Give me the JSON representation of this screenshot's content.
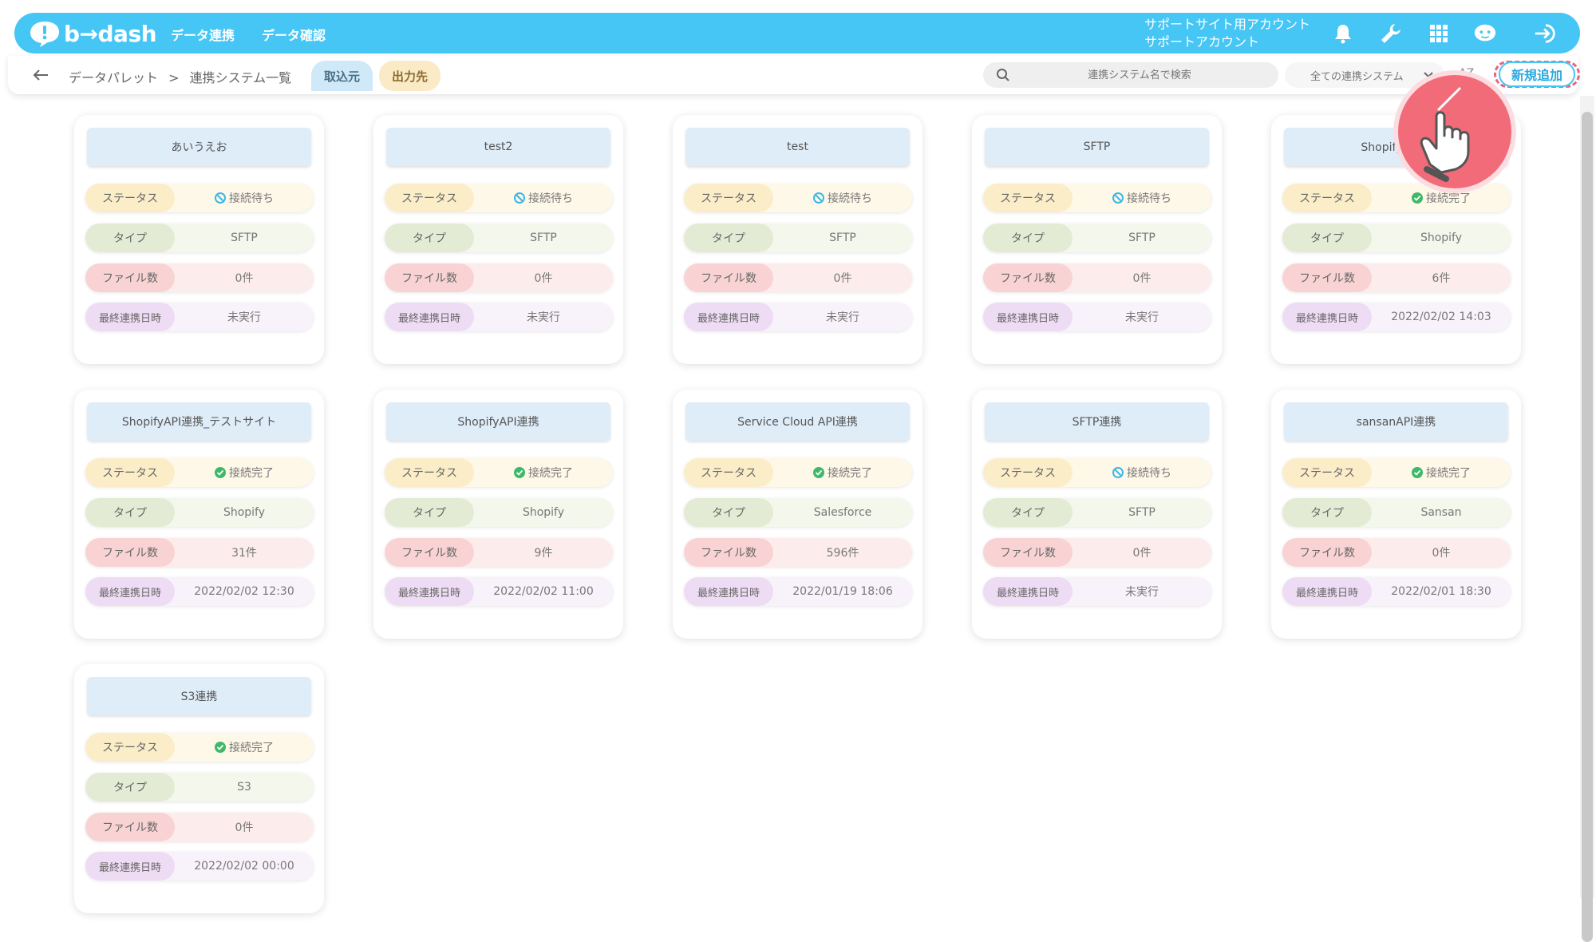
{
  "header": {
    "logo_text": "b→dash",
    "nav": [
      "データ連携",
      "データ確認"
    ],
    "account_line1": "サポートサイト用アカウント",
    "account_line2": "サポートアカウント",
    "icons": [
      "bell-icon",
      "wrench-icon",
      "grid-icon",
      "assistant-icon",
      "logout-icon"
    ],
    "accent_color": "#45c6f5"
  },
  "subbar": {
    "breadcrumb_root": "データパレット",
    "breadcrumb_sep": ">",
    "breadcrumb_current": "連携システム一覧",
    "tab_in": "取込元",
    "tab_out": "出力先",
    "search_placeholder": "連携システム名で検索",
    "filter_value": "全ての連携システム",
    "sort_label": "AZ",
    "new_button": "新規追加"
  },
  "labels": {
    "status": "ステータス",
    "type": "タイプ",
    "files": "ファイル数",
    "last_run": "最終連携日時"
  },
  "status_values": {
    "waiting": "接続待ち",
    "done": "接続完了"
  },
  "cards": [
    {
      "name": "あいうえお",
      "status": "接続待ち",
      "status_kind": "waiting",
      "type": "SFTP",
      "files": "0件",
      "last_run": "未実行"
    },
    {
      "name": "test2",
      "status": "接続待ち",
      "status_kind": "waiting",
      "type": "SFTP",
      "files": "0件",
      "last_run": "未実行"
    },
    {
      "name": "test",
      "status": "接続待ち",
      "status_kind": "waiting",
      "type": "SFTP",
      "files": "0件",
      "last_run": "未実行"
    },
    {
      "name": "SFTP",
      "status": "接続待ち",
      "status_kind": "waiting",
      "type": "SFTP",
      "files": "0件",
      "last_run": "未実行"
    },
    {
      "name": "ShopifyAPI連",
      "status": "接続完了",
      "status_kind": "done",
      "type": "Shopify",
      "files": "6件",
      "last_run": "2022/02/02 14:03"
    },
    {
      "name": "ShopifyAPI連携_テストサイト",
      "status": "接続完了",
      "status_kind": "done",
      "type": "Shopify",
      "files": "31件",
      "last_run": "2022/02/02 12:30"
    },
    {
      "name": "ShopifyAPI連携",
      "status": "接続完了",
      "status_kind": "done",
      "type": "Shopify",
      "files": "9件",
      "last_run": "2022/02/02 11:00"
    },
    {
      "name": "Service Cloud API連携",
      "status": "接続完了",
      "status_kind": "done",
      "type": "Salesforce",
      "files": "596件",
      "last_run": "2022/01/19 18:06"
    },
    {
      "name": "SFTP連携",
      "status": "接続待ち",
      "status_kind": "waiting",
      "type": "SFTP",
      "files": "0件",
      "last_run": "未実行"
    },
    {
      "name": "sansanAPI連携",
      "status": "接続完了",
      "status_kind": "done",
      "type": "Sansan",
      "files": "0件",
      "last_run": "2022/02/01 18:30"
    },
    {
      "name": "S3連携",
      "status": "接続完了",
      "status_kind": "done",
      "type": "S3",
      "files": "0件",
      "last_run": "2022/02/02 00:00"
    }
  ],
  "colors": {
    "waiting_icon": "#3bb6e8",
    "done_icon": "#3fb86a",
    "highlight": "#e8657f"
  }
}
